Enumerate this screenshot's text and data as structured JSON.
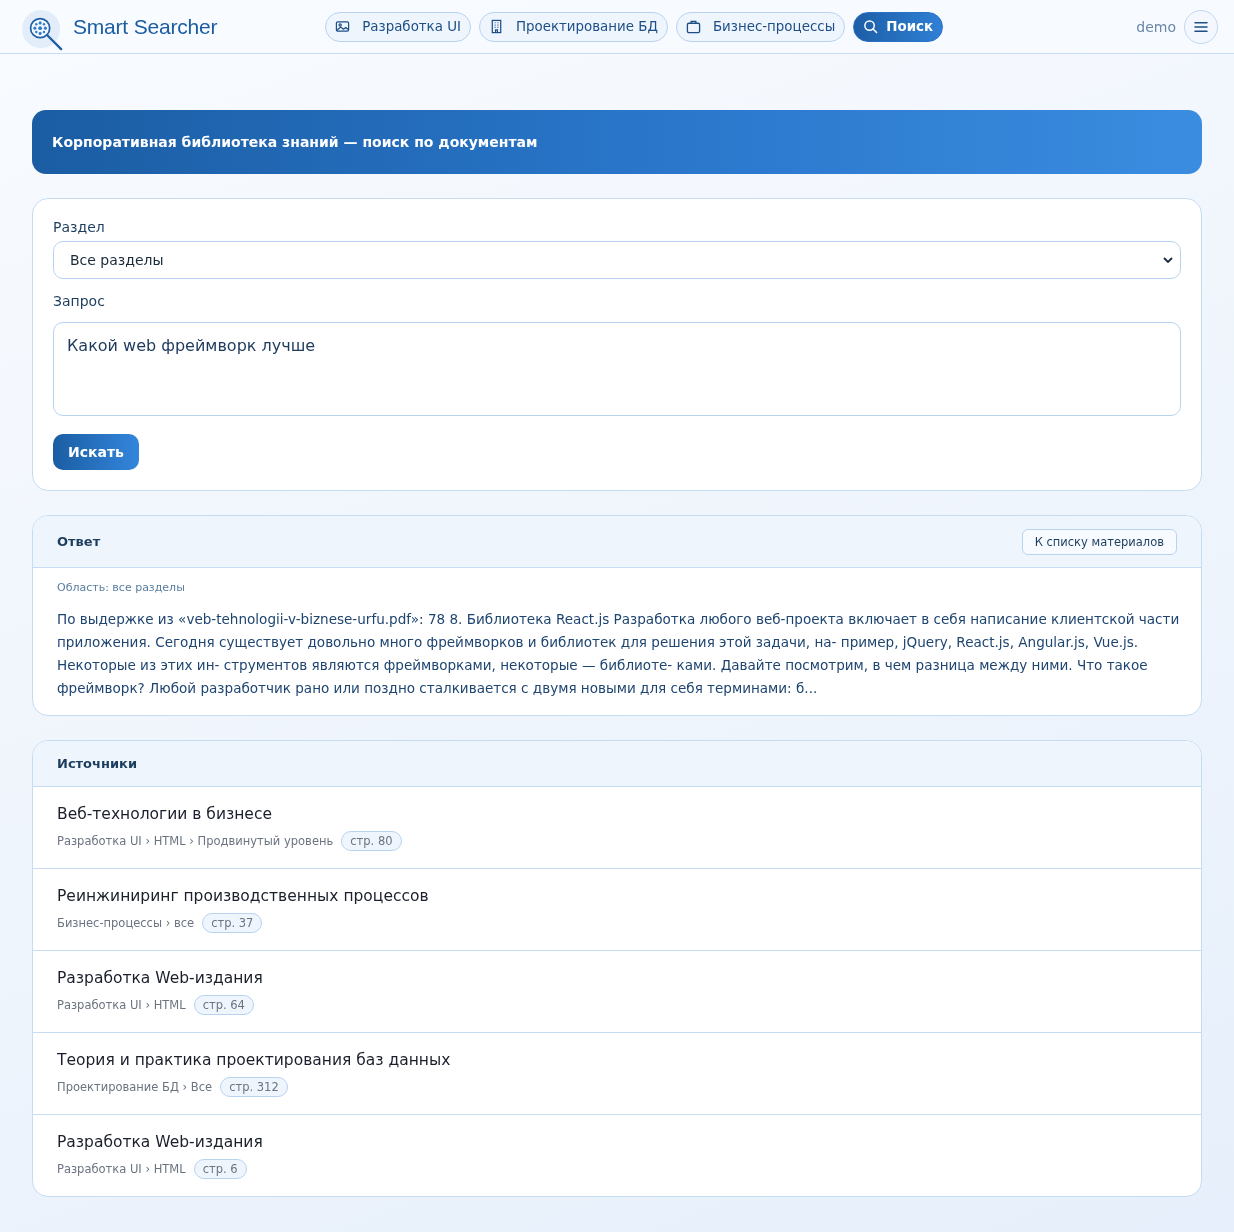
{
  "header": {
    "brand": "Smart Searcher",
    "nav": [
      {
        "label": "Разработка UI",
        "selected": false
      },
      {
        "label": "Проектирование БД",
        "selected": false
      },
      {
        "label": "Бизнес-процессы",
        "selected": false
      },
      {
        "label": "Поиск",
        "selected": true
      }
    ],
    "user": "demo"
  },
  "banner": {
    "title": "Корпоративная библиотека знаний — поиск по документам"
  },
  "search_form": {
    "section_label": "Раздел",
    "section_value": "Все разделы",
    "query_label": "Запрос",
    "query_value": "Какой web фреймворк лучше",
    "submit": "Искать"
  },
  "answer": {
    "title": "Ответ",
    "back_button": "К списку материалов",
    "scope": "Область: все разделы",
    "text": "По выдержке из «veb-tehnologii-v-biznese-urfu.pdf»: 78 8. Библиотека React.js Разработка любого веб-проекта включает в себя написание клиентской части приложения. Сегодня существует довольно много фреймворков и библиотек для решения этой задачи, на- пример, jQuery, React.js, Angular.js, Vue.js. Некоторые из этих ин- струментов являются фреймворками, некоторые — библиоте- ками. Давайте посмотрим, в чем разница между ними. Что такое фреймворк? Любой разработчик рано или поздно сталкивается с двумя новыми для себя терминами: б..."
  },
  "sources": {
    "title": "Источники",
    "items": [
      {
        "title": "Веб-технологии в бизнесе",
        "path": "Разработка UI › HTML › Продвинутый уровень",
        "page": "стр. 80"
      },
      {
        "title": "Реинжиниринг производственных процессов",
        "path": "Бизнес-процессы › все",
        "page": "стр. 37"
      },
      {
        "title": "Разработка Web-издания",
        "path": "Разработка UI › HTML",
        "page": "стр. 64"
      },
      {
        "title": "Теория и практика проектирования баз данных",
        "path": "Проектирование БД › Все",
        "page": "стр. 312"
      },
      {
        "title": "Разработка Web-издания",
        "path": "Разработка UI › HTML",
        "page": "стр. 6"
      }
    ]
  }
}
